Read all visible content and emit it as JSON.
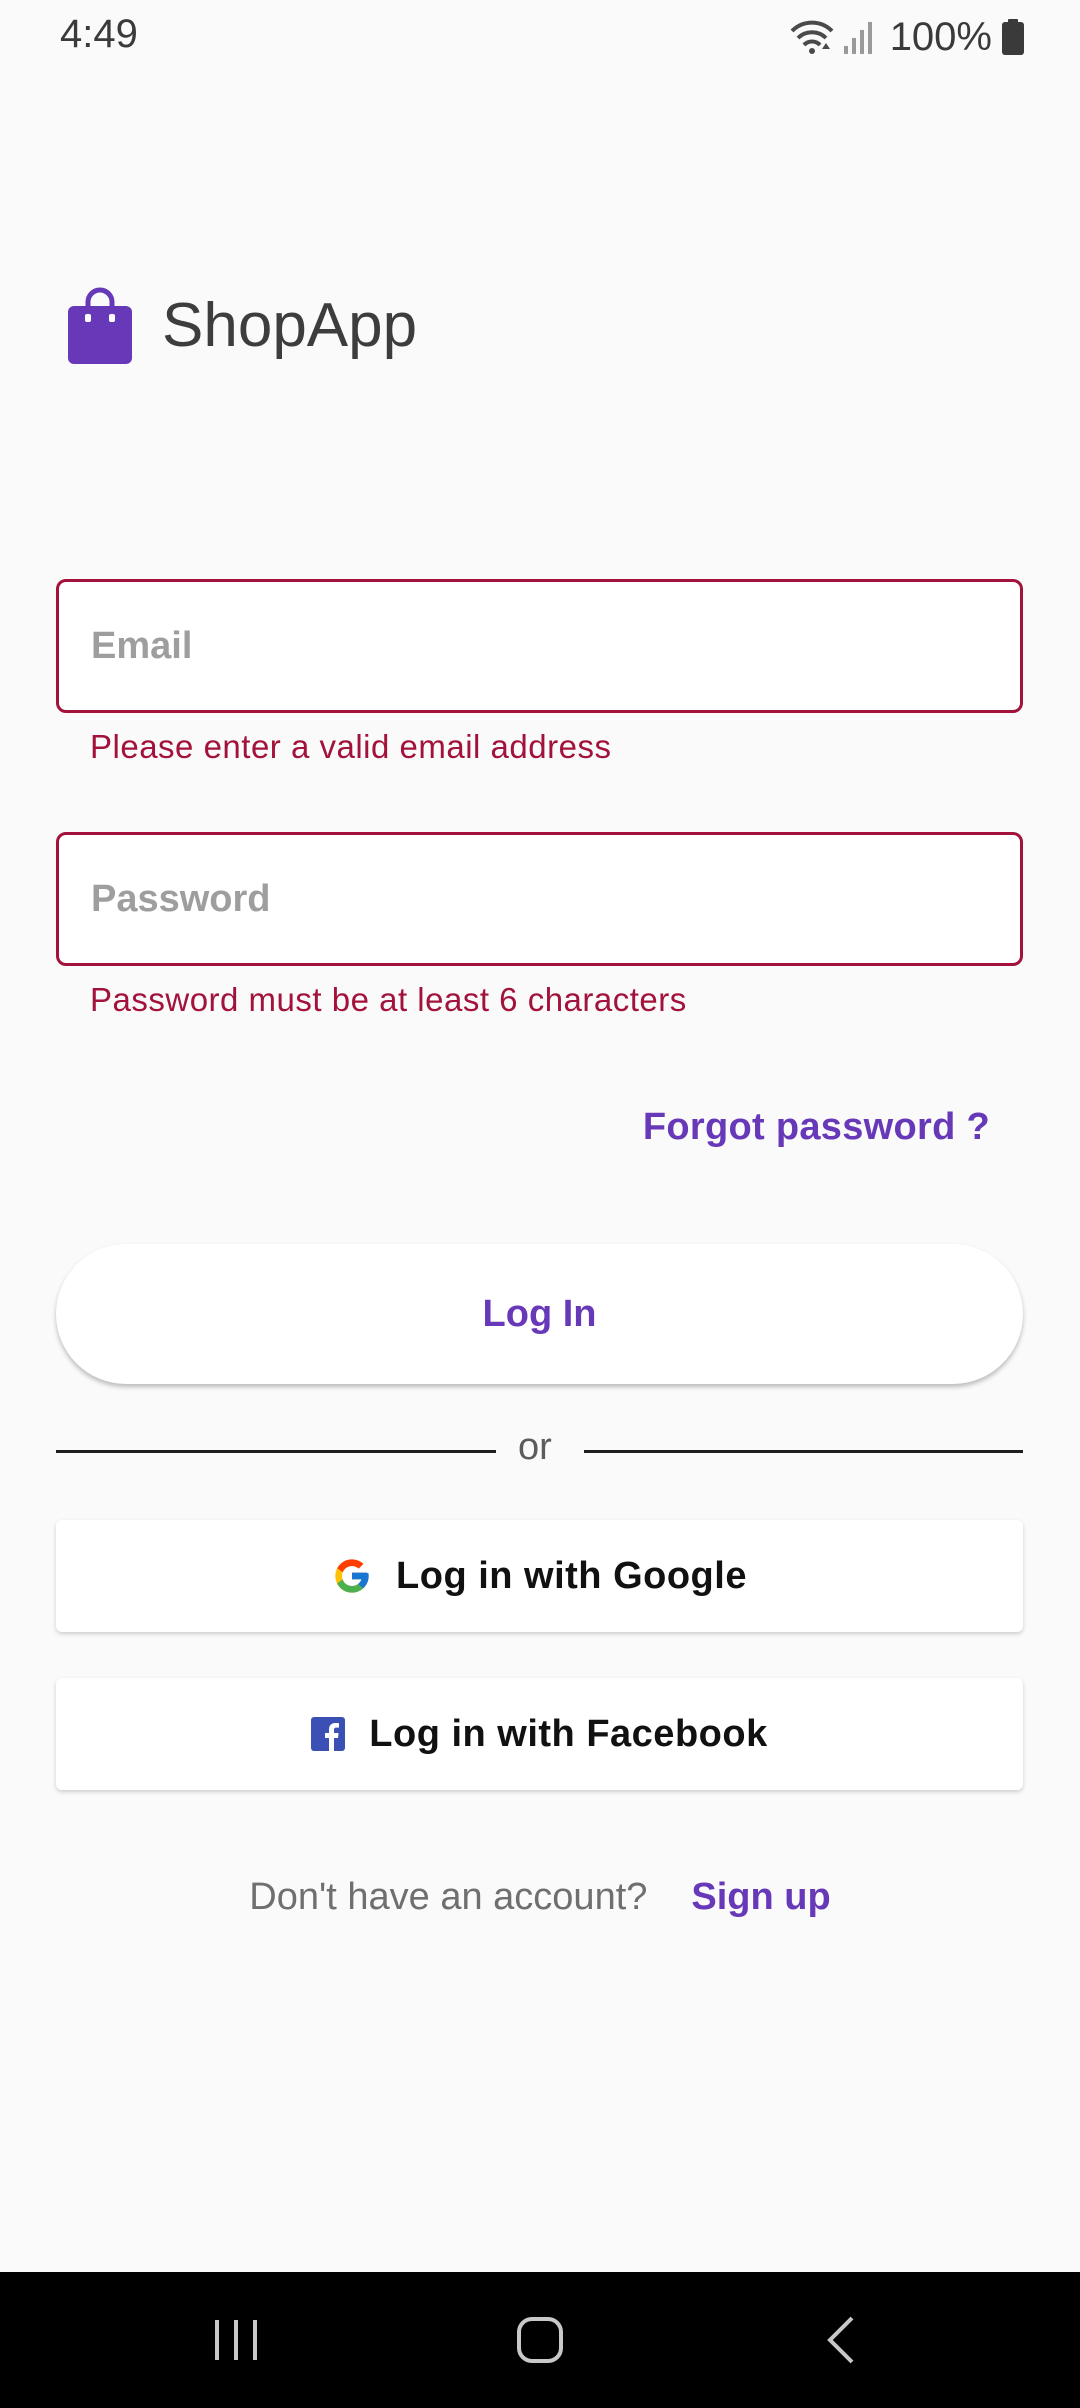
{
  "status_bar": {
    "time": "4:49",
    "battery": "100%",
    "icons": [
      "wifi-icon",
      "signal-icon",
      "battery-icon"
    ]
  },
  "app": {
    "title": "ShopApp",
    "logo_icon": "shopping-bag-icon",
    "accent_color": "#6738b8"
  },
  "form": {
    "email": {
      "placeholder": "Email",
      "value": "",
      "error": "Please enter a valid email address"
    },
    "password": {
      "placeholder": "Password",
      "value": "",
      "error": "Password must be at least 6 characters"
    },
    "error_color": "#a3123a",
    "forgot_label": "Forgot password ?",
    "login_label": "Log In"
  },
  "divider": {
    "label": "or"
  },
  "social": {
    "google_label": "Log in with Google",
    "google_icon": "google-icon",
    "facebook_label": "Log in with Facebook",
    "facebook_icon": "facebook-icon"
  },
  "signup": {
    "prompt": "Don't have an account?",
    "link": "Sign up"
  },
  "nav_bar": {
    "buttons": [
      "recents-icon",
      "home-icon",
      "back-icon"
    ]
  }
}
